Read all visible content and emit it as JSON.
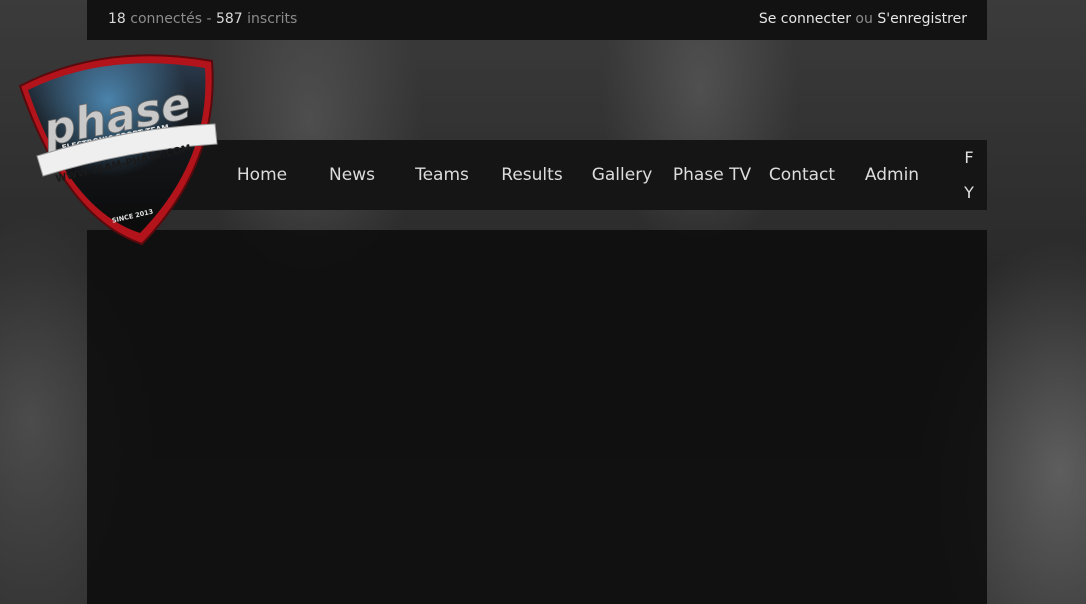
{
  "topbar": {
    "online_count": "18",
    "online_label": "connectés",
    "separator": "-",
    "member_count": "587",
    "member_label": "inscrits",
    "login_label": "Se connecter",
    "or_label": "ou",
    "register_label": "S'enregistrer"
  },
  "logo": {
    "brand_text": "phase",
    "tagline": "ELECTRONIC SPORT TEAM",
    "url": "WWW.TEAM-PHASE.COM",
    "since": "SINCE 2013"
  },
  "nav": {
    "items": [
      {
        "label": "Home"
      },
      {
        "label": "News"
      },
      {
        "label": "Teams"
      },
      {
        "label": "Results"
      },
      {
        "label": "Gallery"
      },
      {
        "label": "Phase TV"
      },
      {
        "label": "Contact"
      },
      {
        "label": "Admin"
      }
    ],
    "social": [
      {
        "label": "F",
        "icon": "facebook-icon"
      },
      {
        "label": "Y",
        "icon": "youtube-icon"
      }
    ]
  },
  "colors": {
    "accent": "#b3141b",
    "bar_background": "#121212",
    "content_background": "#0c0c0c"
  }
}
